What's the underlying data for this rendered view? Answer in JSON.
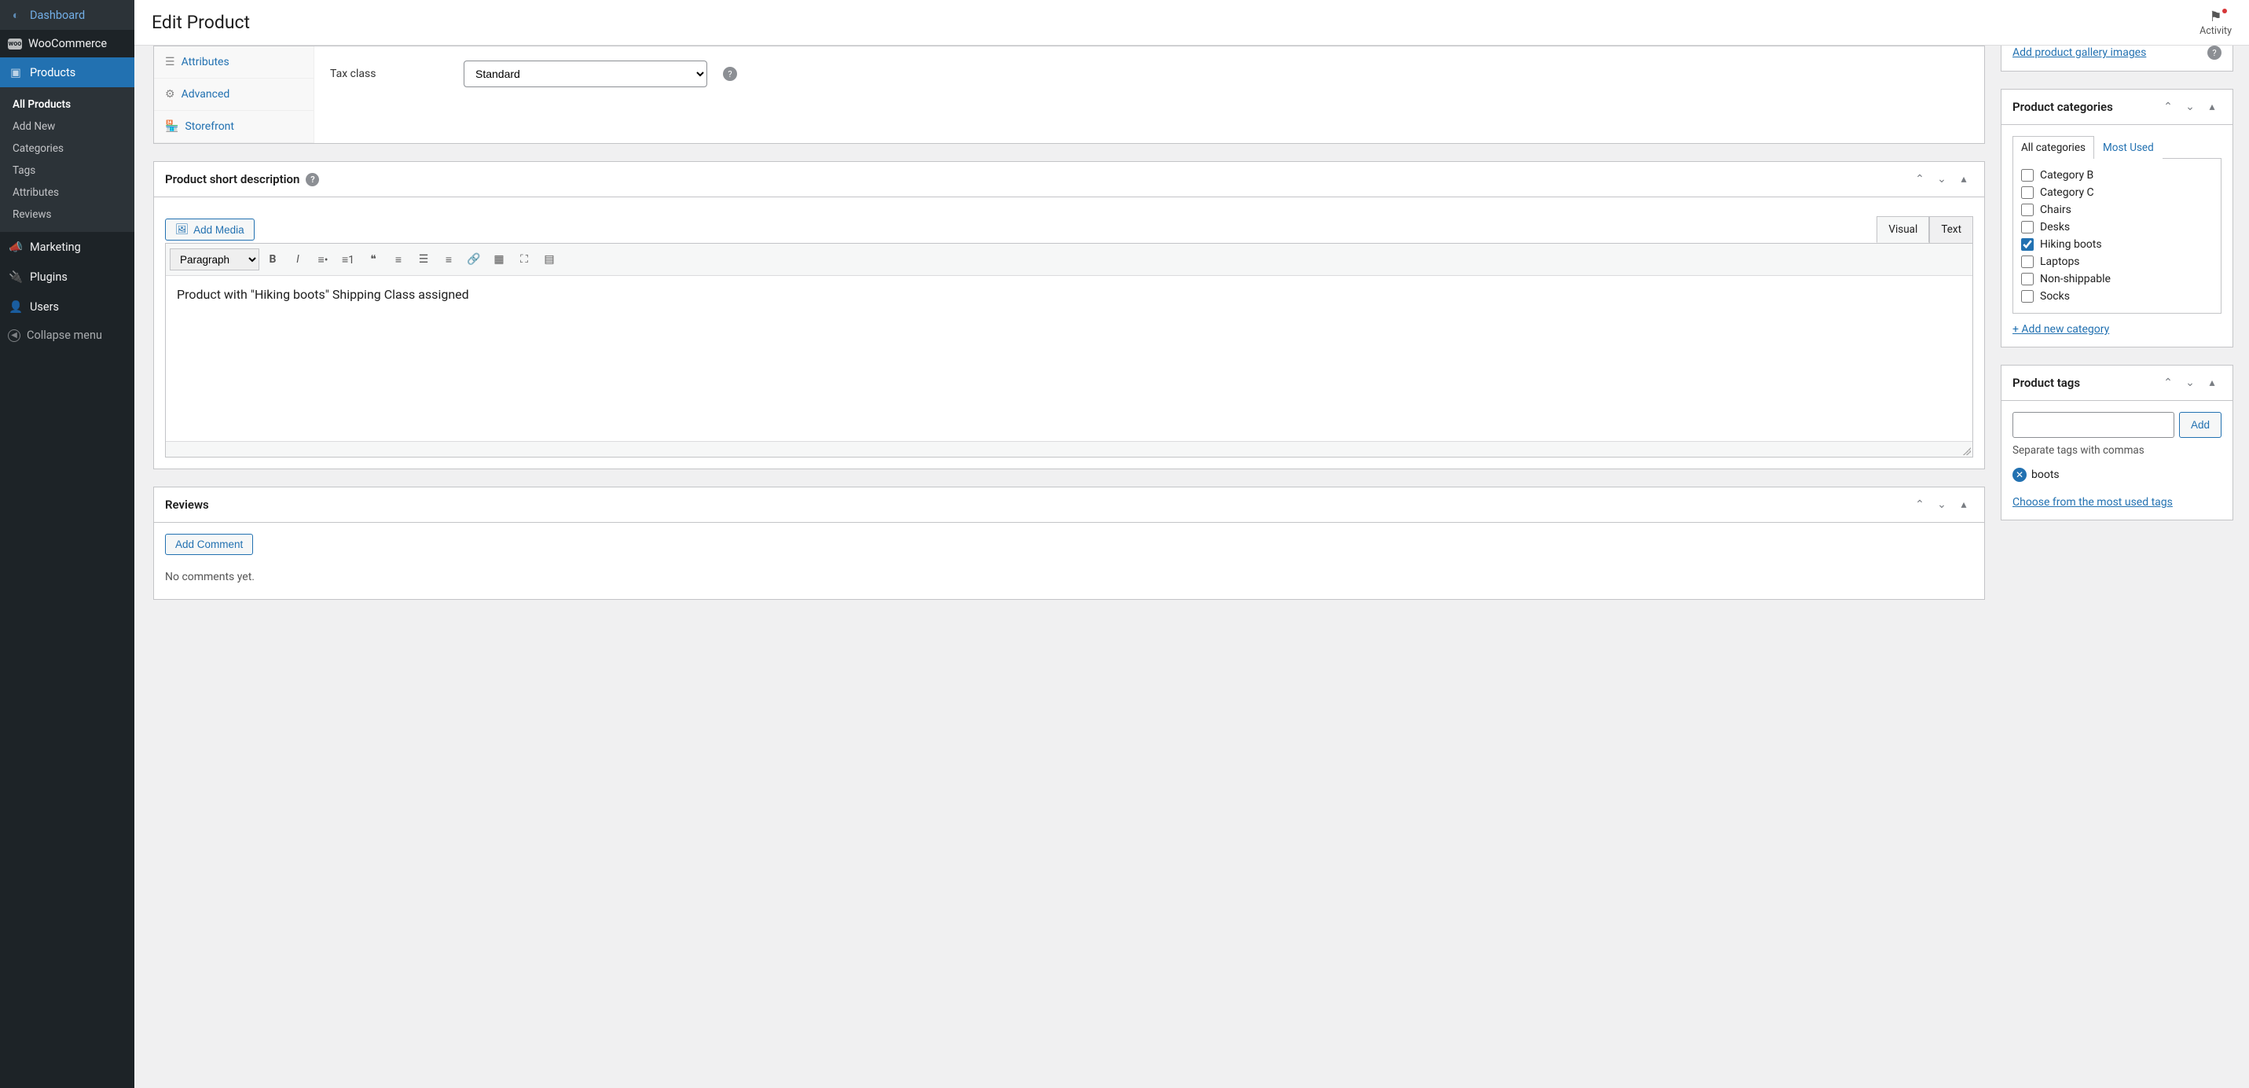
{
  "header": {
    "title": "Edit Product",
    "activity_label": "Activity"
  },
  "sidebar": {
    "items": [
      {
        "label": "Dashboard"
      },
      {
        "label": "WooCommerce"
      },
      {
        "label": "Products"
      },
      {
        "label": "Marketing"
      },
      {
        "label": "Plugins"
      },
      {
        "label": "Users"
      }
    ],
    "submenu": [
      {
        "label": "All Products",
        "current": true
      },
      {
        "label": "Add New"
      },
      {
        "label": "Categories"
      },
      {
        "label": "Tags"
      },
      {
        "label": "Attributes"
      },
      {
        "label": "Reviews"
      }
    ],
    "collapse": "Collapse menu"
  },
  "product_data": {
    "tabs": {
      "attributes": "Attributes",
      "advanced": "Advanced",
      "storefront": "Storefront"
    },
    "tax_class_label": "Tax class",
    "tax_class_value": "Standard"
  },
  "short_desc": {
    "title": "Product short description",
    "add_media": "Add Media",
    "visual_tab": "Visual",
    "text_tab": "Text",
    "format_select": "Paragraph",
    "content": "Product with \"Hiking boots\" Shipping Class assigned"
  },
  "reviews": {
    "title": "Reviews",
    "add_comment": "Add Comment",
    "empty": "No comments yet."
  },
  "gallery": {
    "add_link": "Add product gallery images"
  },
  "categories": {
    "title": "Product categories",
    "tab_all": "All categories",
    "tab_most": "Most Used",
    "items": [
      {
        "label": "Category B",
        "checked": false
      },
      {
        "label": "Category C",
        "checked": false
      },
      {
        "label": "Chairs",
        "checked": false
      },
      {
        "label": "Desks",
        "checked": false
      },
      {
        "label": "Hiking boots",
        "checked": true
      },
      {
        "label": "Laptops",
        "checked": false
      },
      {
        "label": "Non-shippable",
        "checked": false
      },
      {
        "label": "Socks",
        "checked": false
      }
    ],
    "add_new": "+ Add new category"
  },
  "tags": {
    "title": "Product tags",
    "add_btn": "Add",
    "hint": "Separate tags with commas",
    "existing": "boots",
    "choose": "Choose from the most used tags"
  }
}
